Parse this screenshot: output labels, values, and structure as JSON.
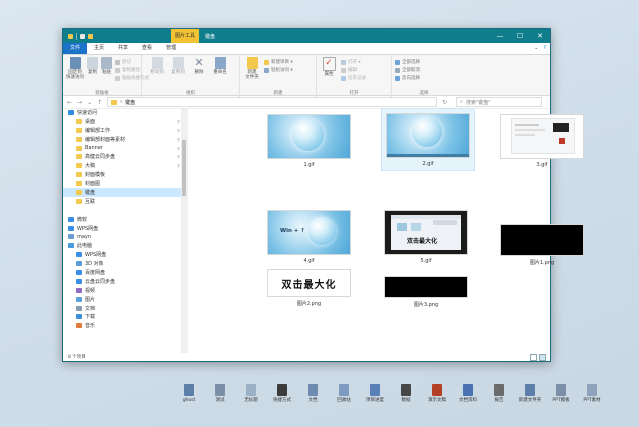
{
  "window": {
    "context_tab": "图片工具",
    "title": "键盘",
    "controls": {
      "minimize": "—",
      "maximize": "☐",
      "close": "✕"
    }
  },
  "tabs": [
    {
      "label": "文件"
    },
    {
      "label": "主页"
    },
    {
      "label": "共享"
    },
    {
      "label": "查看"
    },
    {
      "label": "管理"
    }
  ],
  "ribbon": {
    "clipboard": {
      "label": "剪贴板",
      "pin": "固定到\n快速访问",
      "copy": "复制",
      "paste": "粘贴",
      "cut": "剪切",
      "copy_path": "复制路径",
      "paste_shortcut": "粘贴快捷方式"
    },
    "organize": {
      "label": "组织",
      "move_to": "移动到",
      "copy_to": "复制到",
      "delete": "删除",
      "rename": "重命名"
    },
    "new": {
      "label": "新建",
      "new_folder": "新建\n文件夹",
      "new_item": "新建项目 ▾",
      "easy_access": "轻松访问 ▾"
    },
    "open": {
      "label": "打开",
      "properties": "属性",
      "open": "打开 ▾",
      "edit": "编辑",
      "history": "历史记录"
    },
    "select": {
      "label": "选择",
      "select_all": "全部选择",
      "select_none": "全部取消",
      "invert": "反向选择"
    }
  },
  "address": {
    "back": "←",
    "forward": "→",
    "dropdown": "⌄",
    "up": "↑",
    "separator": "›",
    "path": "键盘",
    "search_placeholder": "搜索\"键盘\""
  },
  "nav_items": [
    {
      "label": "快速访问",
      "icon": "star-icon",
      "color": "#2d8ce0",
      "pinned": false,
      "indent": 0
    },
    {
      "label": "桌面",
      "icon": "folder-icon",
      "color": "#f2c94c",
      "pinned": true,
      "indent": 8
    },
    {
      "label": "编辑部工作",
      "icon": "folder-icon",
      "color": "#f2c94c",
      "pinned": true,
      "indent": 8
    },
    {
      "label": "编辑部封面等素材",
      "icon": "folder-icon",
      "color": "#f2c94c",
      "pinned": true,
      "indent": 8
    },
    {
      "label": "Banner",
      "icon": "folder-icon",
      "color": "#f2c94c",
      "pinned": true,
      "indent": 8
    },
    {
      "label": "高健云同步盘",
      "icon": "folder-icon",
      "color": "#f2c94c",
      "pinned": true,
      "indent": 8
    },
    {
      "label": "大稿",
      "icon": "folder-icon",
      "color": "#f2c94c",
      "pinned": true,
      "indent": 8
    },
    {
      "label": "封面模板",
      "icon": "folder-icon",
      "color": "#f2c94c",
      "pinned": false,
      "indent": 8
    },
    {
      "label": "封面图",
      "icon": "folder-icon",
      "color": "#f2c94c",
      "pinned": false,
      "indent": 8
    },
    {
      "label": "键盘",
      "icon": "folder-icon",
      "color": "#f2c94c",
      "pinned": false,
      "indent": 8
    },
    {
      "label": "互联",
      "icon": "folder-icon",
      "color": "#f2c94c",
      "pinned": false,
      "indent": 8
    },
    {
      "label": "",
      "icon": "spacer",
      "color": "",
      "pinned": false,
      "indent": 0
    },
    {
      "label": "微软",
      "icon": "cloud-icon",
      "color": "#3a8ee6",
      "pinned": false,
      "indent": 0
    },
    {
      "label": "WPS网盘",
      "icon": "cloud-icon",
      "color": "#3a8ee6",
      "pinned": false,
      "indent": 0
    },
    {
      "label": "mayn",
      "icon": "user-icon",
      "color": "#6b9bd1",
      "pinned": false,
      "indent": 0
    },
    {
      "label": "此电脑",
      "icon": "computer-icon",
      "color": "#4a9ae0",
      "pinned": false,
      "indent": 0
    },
    {
      "label": "WPS网盘",
      "icon": "cloud-icon",
      "color": "#3a8ee6",
      "pinned": false,
      "indent": 8
    },
    {
      "label": "3D 对象",
      "icon": "cube-icon",
      "color": "#5b9bd5",
      "pinned": false,
      "indent": 8
    },
    {
      "label": "百度网盘",
      "icon": "cloud-icon",
      "color": "#3a8ee6",
      "pinned": false,
      "indent": 8
    },
    {
      "label": "云盘云同步盘",
      "icon": "cloud-icon",
      "color": "#3a8ee6",
      "pinned": false,
      "indent": 8
    },
    {
      "label": "视频",
      "icon": "video-icon",
      "color": "#8e6bc8",
      "pinned": false,
      "indent": 8
    },
    {
      "label": "图片",
      "icon": "picture-icon",
      "color": "#5aa0d8",
      "pinned": false,
      "indent": 8
    },
    {
      "label": "文档",
      "icon": "document-icon",
      "color": "#8a9bb0",
      "pinned": false,
      "indent": 8
    },
    {
      "label": "下载",
      "icon": "download-icon",
      "color": "#3b8ed8",
      "pinned": false,
      "indent": 8
    },
    {
      "label": "音乐",
      "icon": "music-icon",
      "color": "#e07a3b",
      "pinned": false,
      "indent": 8
    }
  ],
  "files": [
    {
      "name": "1.gif",
      "kind": "wallpaper"
    },
    {
      "name": "2.gif",
      "kind": "wallpaper-taskbar"
    },
    {
      "name": "3.gif",
      "kind": "screenshot"
    },
    {
      "name": "4.gif",
      "kind": "wallpaper-text",
      "overlay": "Win + ↑"
    },
    {
      "name": "5.gif",
      "kind": "window-shot",
      "overlay": "双击最大化"
    },
    {
      "name": "图片1.png",
      "kind": "black"
    },
    {
      "name": "图片2.png",
      "kind": "text-card",
      "overlay": "双击最大化"
    },
    {
      "name": "图片3.png",
      "kind": "black"
    }
  ],
  "status": {
    "count": "8 个项目"
  },
  "desktop_icons": [
    {
      "label": "ghost",
      "color": "#5b7fa8"
    },
    {
      "label": "测试",
      "color": "#7a8fa8"
    },
    {
      "label": "无标题",
      "color": "#9ab0c4"
    },
    {
      "label": "快捷方式",
      "color": "#3b3b3b"
    },
    {
      "label": "文档",
      "color": "#6d8bb0"
    },
    {
      "label": "回收站",
      "color": "#7b9cc0"
    },
    {
      "label": "项目进度",
      "color": "#5a80b8"
    },
    {
      "label": "数据",
      "color": "#474747"
    },
    {
      "label": "演示文稿",
      "color": "#b34024"
    },
    {
      "label": "文档资料",
      "color": "#4a72b0"
    },
    {
      "label": "报告",
      "color": "#6b6b6b"
    },
    {
      "label": "新建文件夹",
      "color": "#5b7fa8"
    },
    {
      "label": "PPT模板",
      "color": "#7b8fa8"
    },
    {
      "label": "PPT素材",
      "color": "#8ea3bb"
    }
  ]
}
